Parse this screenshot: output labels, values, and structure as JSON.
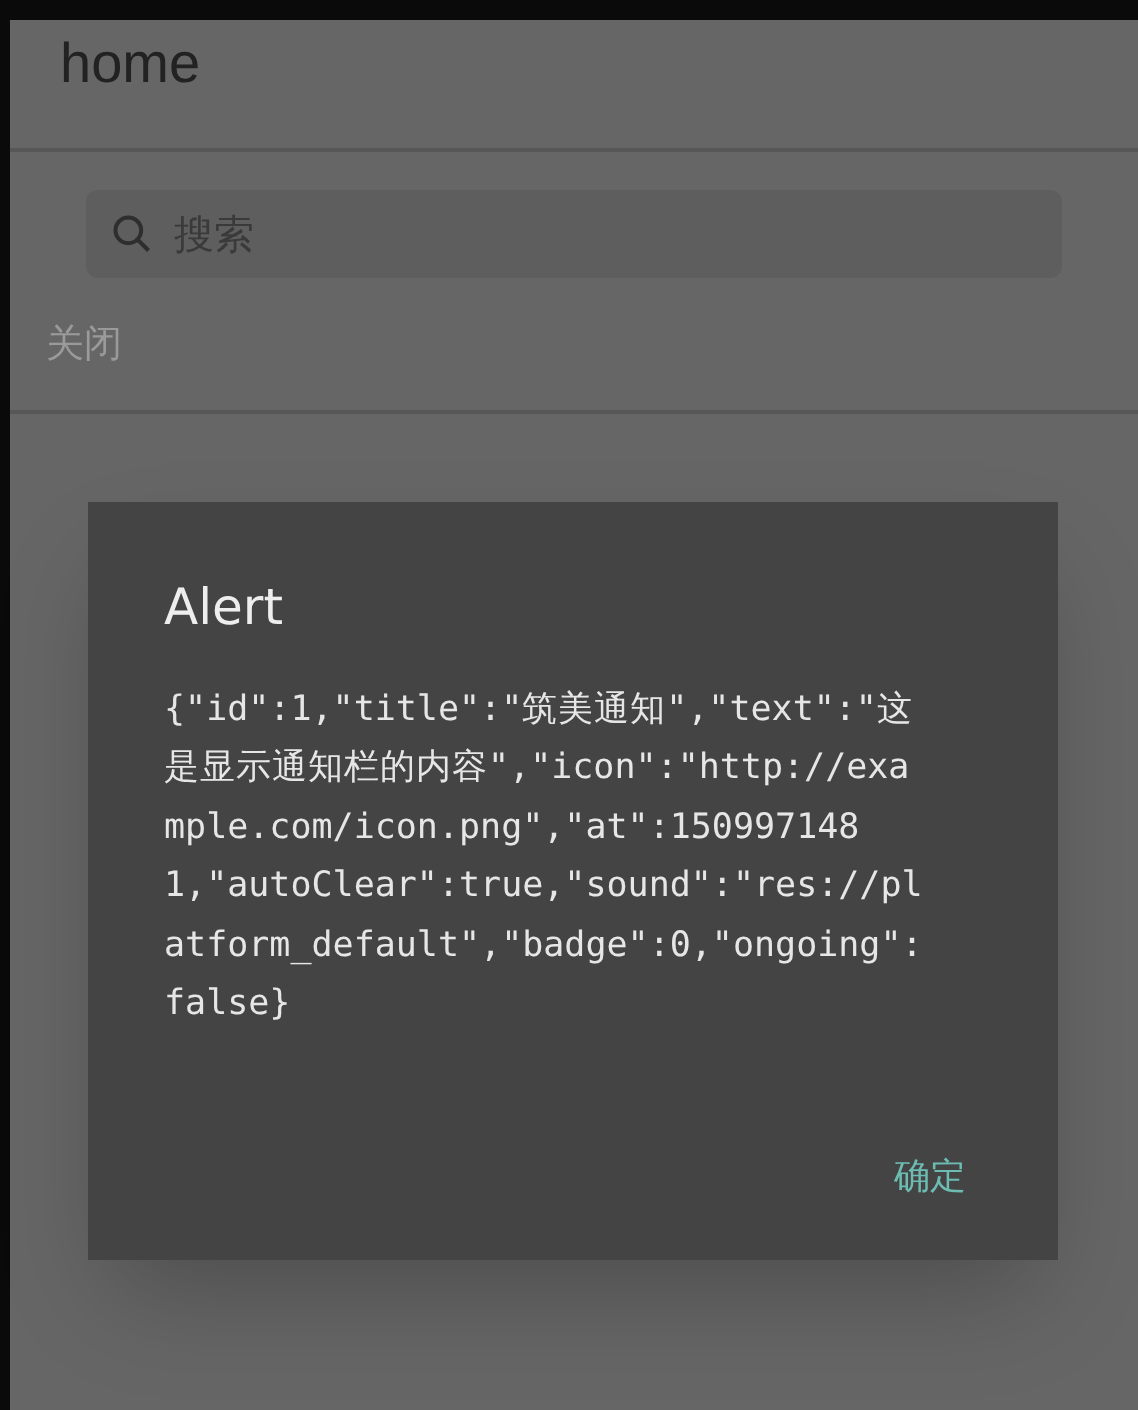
{
  "app_bar": {
    "title": "home"
  },
  "search": {
    "placeholder": "搜索"
  },
  "close_link": "关闭",
  "dialog": {
    "title": "Alert",
    "message": "{\"id\":1,\"title\":\"筑美通知\",\"text\":\"这是显示通知栏的内容\",\"icon\":\"http://example.com/icon.png\",\"at\":1509971481,\"autoClear\":true,\"sound\":\"res://platform_default\",\"badge\":0,\"ongoing\":false}",
    "buttons": [
      "确定"
    ]
  }
}
